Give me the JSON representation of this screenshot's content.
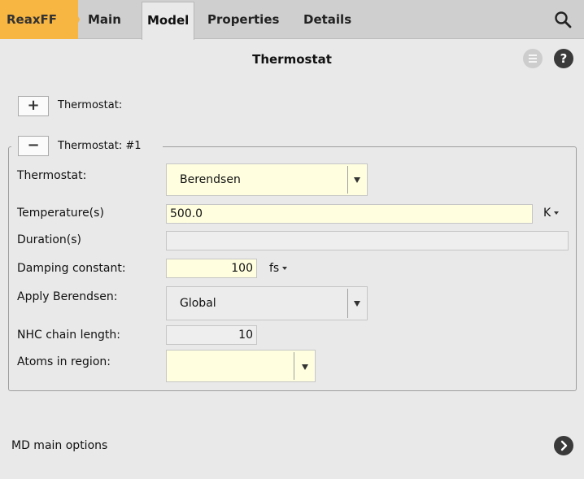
{
  "tabs": {
    "app": "ReaxFF",
    "main": "Main",
    "model": "Model",
    "properties": "Properties",
    "details": "Details"
  },
  "page": {
    "title": "Thermostat"
  },
  "expanders": {
    "add_label": "Thermostat:",
    "group_label": "Thermostat: #1",
    "plus": "+",
    "minus": "−"
  },
  "form": {
    "thermostat_label": "Thermostat:",
    "thermostat_value": "Berendsen",
    "temperature_label": "Temperature(s)",
    "temperature_value": "500.0",
    "temperature_unit": "K",
    "duration_label": "Duration(s)",
    "duration_value": "",
    "damping_label": "Damping constant:",
    "damping_value": "100",
    "damping_unit": "fs",
    "apply_label": "Apply Berendsen:",
    "apply_value": "Global",
    "nhc_label": "NHC chain length:",
    "nhc_value": "10",
    "atoms_label": "Atoms in region:",
    "atoms_value": ""
  },
  "footer": {
    "link": "MD main options"
  },
  "icons": {
    "search": "search-icon",
    "menu": "menu-icon",
    "help": "help-icon",
    "next": "chevron-right-icon"
  },
  "colors": {
    "accent": "#f7b541",
    "field_bg": "#ffffe0"
  }
}
